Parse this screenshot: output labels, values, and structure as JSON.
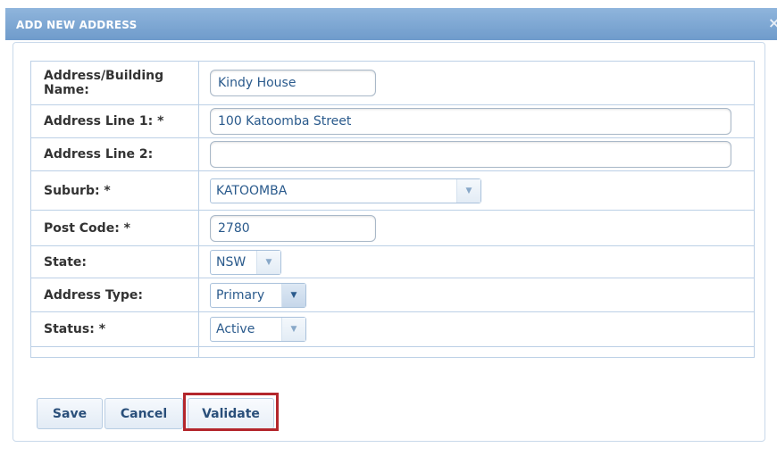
{
  "dialog": {
    "title": "ADD NEW ADDRESS",
    "close_glyph": "×"
  },
  "form": {
    "rows": [
      {
        "label": "Address/Building Name:",
        "value": "Kindy House"
      },
      {
        "label": "Address Line 1: *",
        "value": "100 Katoomba Street"
      },
      {
        "label": "Address Line 2:",
        "value": ""
      },
      {
        "label": "Suburb: *",
        "value": "KATOOMBA"
      },
      {
        "label": "Post Code: *",
        "value": "2780"
      },
      {
        "label": "State:",
        "value": "NSW"
      },
      {
        "label": "Address Type:",
        "value": "Primary"
      },
      {
        "label": "Status: *",
        "value": "Active"
      }
    ]
  },
  "buttons": {
    "save": "Save",
    "cancel": "Cancel",
    "validate": "Validate"
  },
  "icons": {
    "dropdown": "chevron-down-icon",
    "close": "close-icon"
  },
  "colors": {
    "titlebar": "#7ea7d4",
    "highlight": "#b3262c",
    "value_text": "#2a5a8c"
  }
}
